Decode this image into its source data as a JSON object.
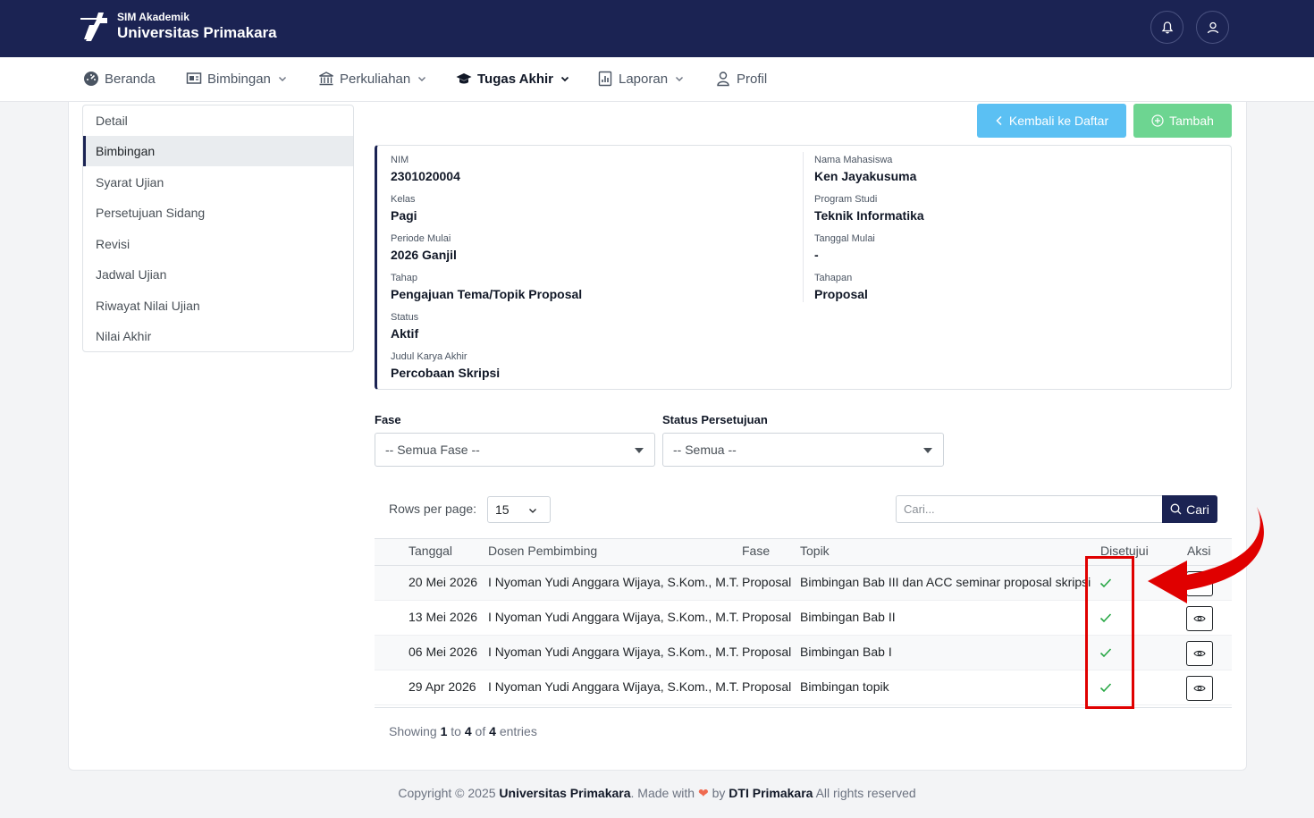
{
  "header": {
    "app_sub": "SIM Akademik",
    "app_name": "Universitas Primakara"
  },
  "nav": [
    {
      "label": "Beranda",
      "icon": "dashboard-icon"
    },
    {
      "label": "Bimbingan",
      "icon": "presentation-icon"
    },
    {
      "label": "Perkuliahan",
      "icon": "institution-icon"
    },
    {
      "label": "Tugas Akhir",
      "icon": "graduation-cap-icon",
      "active": true
    },
    {
      "label": "Laporan",
      "icon": "report-icon"
    },
    {
      "label": "Profil",
      "icon": "user-icon"
    }
  ],
  "side_menu": [
    "Detail",
    "Bimbingan",
    "Syarat Ujian",
    "Persetujuan Sidang",
    "Revisi",
    "Jadwal Ujian",
    "Riwayat Nilai Ujian",
    "Nilai Akhir"
  ],
  "side_menu_active": "Bimbingan",
  "actions": {
    "back": "Kembali ke Daftar",
    "add": "Tambah"
  },
  "info": {
    "nim_label": "NIM",
    "nim": "2301020004",
    "nama_label": "Nama Mahasiswa",
    "nama": "Ken Jayakusuma",
    "kelas_label": "Kelas",
    "kelas": "Pagi",
    "prodi_label": "Program Studi",
    "prodi": "Teknik Informatika",
    "periode_label": "Periode Mulai",
    "periode": "2026 Ganjil",
    "tgl_mulai_label": "Tanggal Mulai",
    "tgl_mulai": "-",
    "tahap_label": "Tahap",
    "tahap": "Pengajuan Tema/Topik Proposal",
    "tahapan_label": "Tahapan",
    "tahapan": "Proposal",
    "status_label": "Status",
    "status": "Aktif",
    "judul_label": "Judul Karya Akhir",
    "judul": "Percobaan Skripsi"
  },
  "filters": {
    "fase_label": "Fase",
    "fase_value": "-- Semua Fase --",
    "status_label": "Status Persetujuan",
    "status_value": "-- Semua --"
  },
  "table_controls": {
    "rows_per_page_label": "Rows per page:",
    "rows_per_page": "15",
    "search_placeholder": "Cari...",
    "search_button": "Cari"
  },
  "table": {
    "columns": [
      "Tanggal",
      "Dosen Pembimbing",
      "Fase",
      "Topik",
      "Disetujui",
      "Aksi"
    ],
    "rows": [
      {
        "tanggal": "20 Mei 2026",
        "dosen": "I Nyoman Yudi Anggara Wijaya, S.Kom., M.T.",
        "fase": "Proposal",
        "topik": "Bimbingan Bab III dan ACC seminar proposal skripsi",
        "disetujui": true
      },
      {
        "tanggal": "13 Mei 2026",
        "dosen": "I Nyoman Yudi Anggara Wijaya, S.Kom., M.T.",
        "fase": "Proposal",
        "topik": "Bimbingan Bab II",
        "disetujui": true
      },
      {
        "tanggal": "06 Mei 2026",
        "dosen": "I Nyoman Yudi Anggara Wijaya, S.Kom., M.T.",
        "fase": "Proposal",
        "topik": "Bimbingan Bab I",
        "disetujui": true
      },
      {
        "tanggal": "29 Apr 2026",
        "dosen": "I Nyoman Yudi Anggara Wijaya, S.Kom., M.T.",
        "fase": "Proposal",
        "topik": "Bimbingan topik",
        "disetujui": true
      }
    ]
  },
  "summary": {
    "prefix": "Showing",
    "from": "1",
    "to_word": "to",
    "to": "4",
    "of_word": "of",
    "total": "4",
    "suffix": "entries"
  },
  "footer": {
    "copyright": "Copyright © 2025",
    "org": "Universitas Primakara",
    "made_with": ". Made with",
    "by": "by",
    "team": "DTI Primakara",
    "rights": "All rights reserved"
  },
  "colors": {
    "navy": "#1b2353",
    "info": "#5bc0f3",
    "success": "#6dd591",
    "check": "#28a745",
    "annotation": "#e00000"
  }
}
